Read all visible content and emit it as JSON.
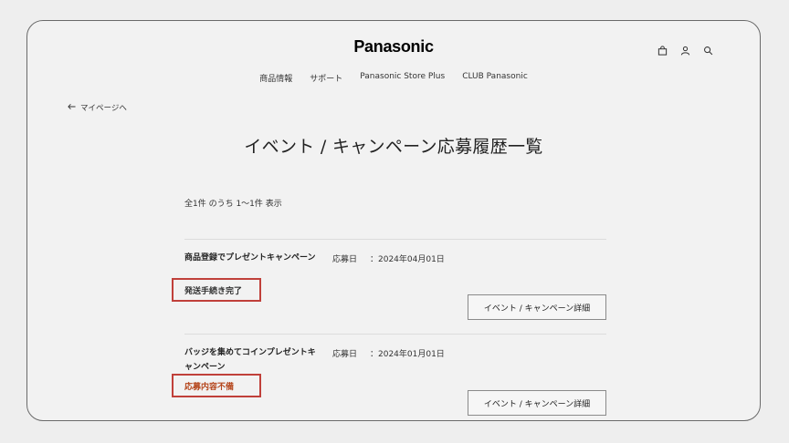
{
  "header": {
    "logo_text": "Panasonic",
    "icons": [
      "bag-icon",
      "user-icon",
      "search-icon"
    ]
  },
  "nav": {
    "items": [
      "商品情報",
      "サポート",
      "Panasonic Store Plus",
      "CLUB Panasonic"
    ]
  },
  "back_link": {
    "label": "マイページへ"
  },
  "page": {
    "title": "イベント / キャンペーン応募履歴一覧",
    "count_text": "全1件 のうち 1〜1件 表示"
  },
  "entries": [
    {
      "title": "商品登録でプレゼントキャンペーン",
      "date_label": "応募日",
      "date_value": "：2024年04月01日",
      "status": "発送手続き完了",
      "status_color": "#333333",
      "detail_label": "イベント / キャンペーン詳細"
    },
    {
      "title": "バッジを集めてコインプレゼントキャンペーン",
      "date_label": "応募日",
      "date_value": "：2024年01月01日",
      "status": "応募内容不備",
      "status_color": "#b5461c",
      "detail_label": "イベント / キャンペーン詳細"
    }
  ],
  "colors": {
    "highlight_box": "#c0403a",
    "background": "#f2f2f2"
  }
}
